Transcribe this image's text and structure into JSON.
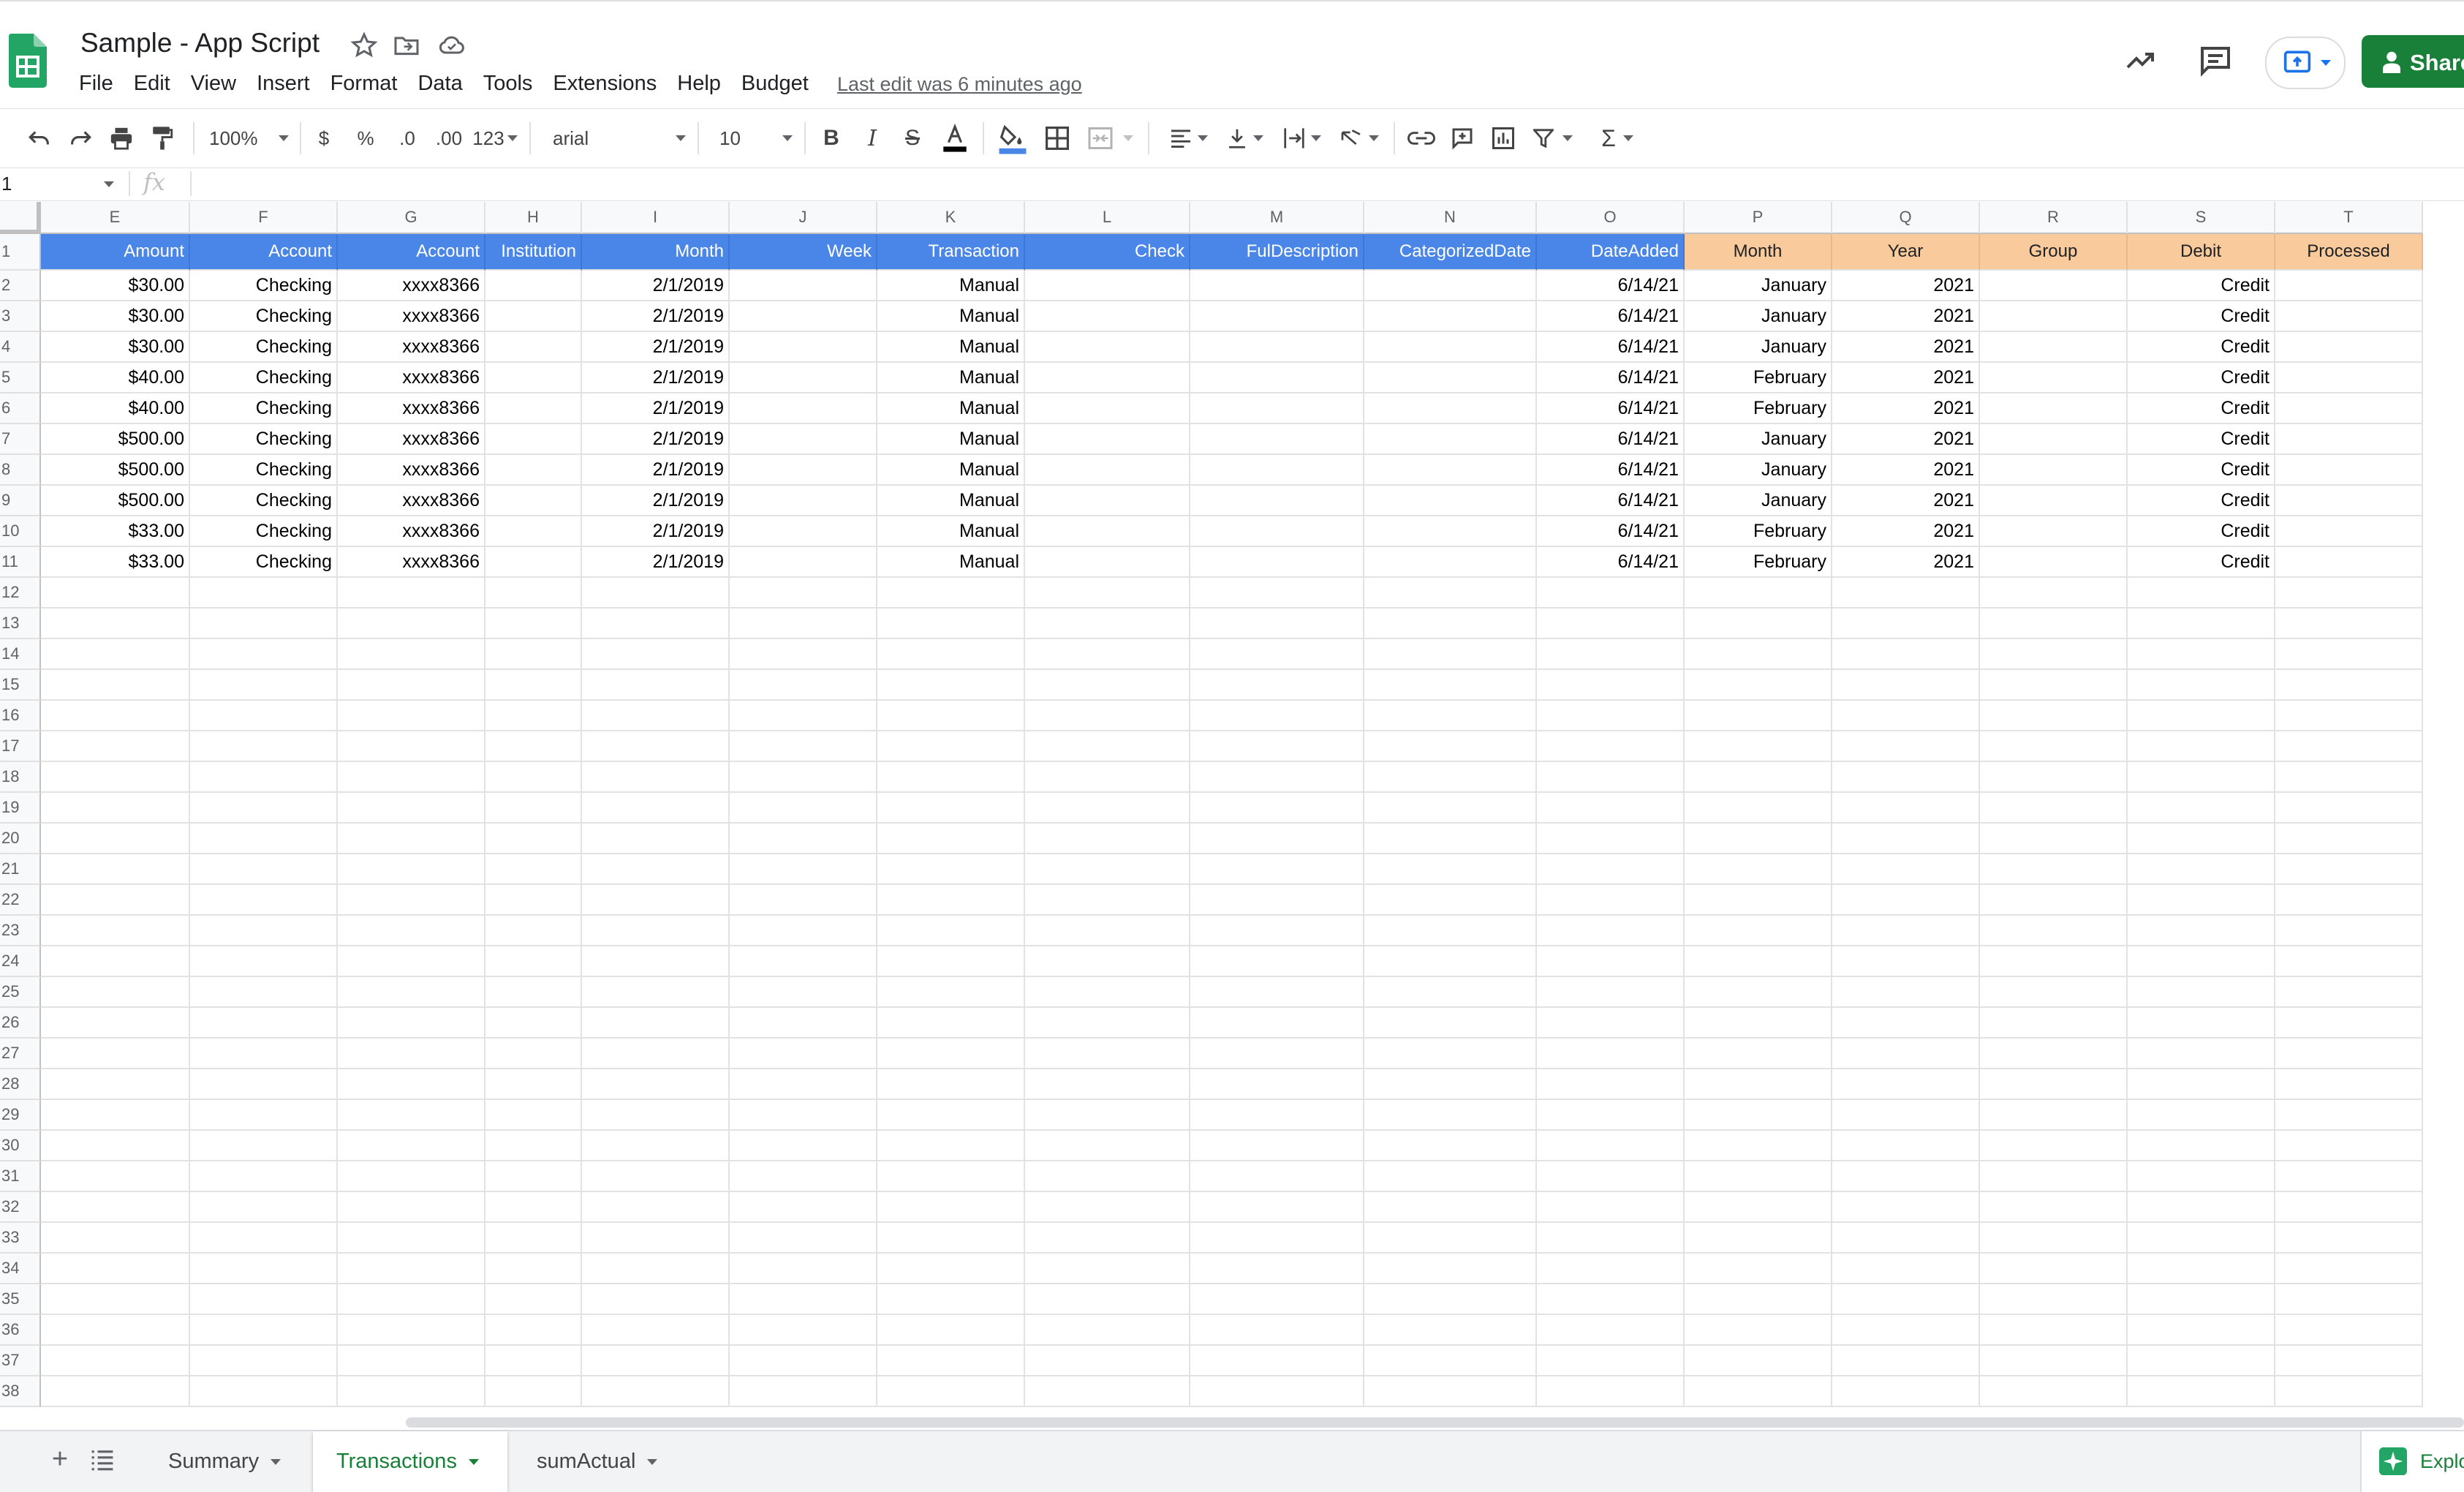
{
  "app": {
    "title": "Sample - App Script",
    "menus": [
      "File",
      "Edit",
      "View",
      "Insert",
      "Format",
      "Data",
      "Tools",
      "Extensions",
      "Help",
      "Budget"
    ],
    "last_edit": "Last edit was 6 minutes ago",
    "share_label": "Share"
  },
  "toolbar": {
    "zoom": "100%",
    "currency": "$",
    "percent": "%",
    "dec_decrease": ".0",
    "dec_increase": ".00",
    "more_formats": "123",
    "font": "arial",
    "font_size": "10"
  },
  "formula_bar": {
    "name_box": "1",
    "fx": "fx"
  },
  "colors": {
    "header_blue": "#4a86e8",
    "header_orange": "#f9cb9c",
    "brand_green": "#188038"
  },
  "grid": {
    "columns": [
      "E",
      "F",
      "G",
      "H",
      "I",
      "J",
      "K",
      "L",
      "M",
      "N",
      "O",
      "P",
      "Q",
      "R",
      "S",
      "T"
    ],
    "row_numbers": [
      "1",
      "2",
      "3",
      "4",
      "5",
      "6",
      "7",
      "8",
      "9",
      "10",
      "11",
      "12",
      "13",
      "14",
      "15",
      "16",
      "17",
      "18",
      "19",
      "20",
      "21",
      "22",
      "23",
      "24",
      "25",
      "26",
      "27",
      "28",
      "29",
      "30",
      "31",
      "32",
      "33",
      "34",
      "35",
      "36",
      "37",
      "38"
    ],
    "header_row": [
      "Amount",
      "Account",
      "Account",
      "Institution",
      "Month",
      "Week",
      "Transaction",
      "Check",
      "FulDescription",
      "CategorizedDate",
      "DateAdded",
      "Month",
      "Year",
      "Group",
      "Debit",
      "Processed"
    ],
    "rows": [
      [
        "$30.00",
        "Checking",
        "xxxx8366",
        "",
        "2/1/2019",
        "",
        "Manual",
        "",
        "",
        "",
        "6/14/21",
        "January",
        "2021",
        "",
        "Credit",
        ""
      ],
      [
        "$30.00",
        "Checking",
        "xxxx8366",
        "",
        "2/1/2019",
        "",
        "Manual",
        "",
        "",
        "",
        "6/14/21",
        "January",
        "2021",
        "",
        "Credit",
        ""
      ],
      [
        "$30.00",
        "Checking",
        "xxxx8366",
        "",
        "2/1/2019",
        "",
        "Manual",
        "",
        "",
        "",
        "6/14/21",
        "January",
        "2021",
        "",
        "Credit",
        ""
      ],
      [
        "$40.00",
        "Checking",
        "xxxx8366",
        "",
        "2/1/2019",
        "",
        "Manual",
        "",
        "",
        "",
        "6/14/21",
        "February",
        "2021",
        "",
        "Credit",
        ""
      ],
      [
        "$40.00",
        "Checking",
        "xxxx8366",
        "",
        "2/1/2019",
        "",
        "Manual",
        "",
        "",
        "",
        "6/14/21",
        "February",
        "2021",
        "",
        "Credit",
        ""
      ],
      [
        "$500.00",
        "Checking",
        "xxxx8366",
        "",
        "2/1/2019",
        "",
        "Manual",
        "",
        "",
        "",
        "6/14/21",
        "January",
        "2021",
        "",
        "Credit",
        ""
      ],
      [
        "$500.00",
        "Checking",
        "xxxx8366",
        "",
        "2/1/2019",
        "",
        "Manual",
        "",
        "",
        "",
        "6/14/21",
        "January",
        "2021",
        "",
        "Credit",
        ""
      ],
      [
        "$500.00",
        "Checking",
        "xxxx8366",
        "",
        "2/1/2019",
        "",
        "Manual",
        "",
        "",
        "",
        "6/14/21",
        "January",
        "2021",
        "",
        "Credit",
        ""
      ],
      [
        "$33.00",
        "Checking",
        "xxxx8366",
        "",
        "2/1/2019",
        "",
        "Manual",
        "",
        "",
        "",
        "6/14/21",
        "February",
        "2021",
        "",
        "Credit",
        ""
      ],
      [
        "$33.00",
        "Checking",
        "xxxx8366",
        "",
        "2/1/2019",
        "",
        "Manual",
        "",
        "",
        "",
        "6/14/21",
        "February",
        "2021",
        "",
        "Credit",
        ""
      ]
    ]
  },
  "sheets": {
    "tabs": [
      "Summary",
      "Transactions",
      "sumActual"
    ],
    "active": "Transactions"
  },
  "explore_label": "Explore"
}
